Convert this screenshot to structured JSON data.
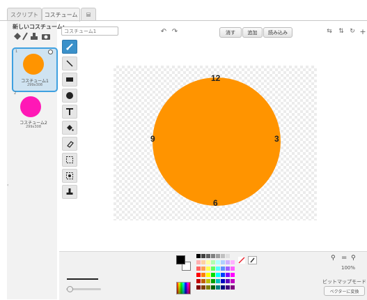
{
  "tabs": [
    {
      "label": "スクリプト",
      "active": false
    },
    {
      "label": "コスチューム",
      "active": true
    },
    {
      "label": "",
      "icon": "speaker-icon",
      "active": false
    }
  ],
  "costume_panel": {
    "new_costume_label": "新しいコスチューム:",
    "new_costume_icons": [
      "paint-brush-icon",
      "stamp-icon",
      "camera-icon"
    ],
    "costumes": [
      {
        "number": "1",
        "name": "コスチューム1",
        "size": "299x308",
        "color": "#ff9400",
        "selected": true
      },
      {
        "number": "2",
        "name": "コスチューム2",
        "size": "299x308",
        "color": "#ff18b6",
        "selected": false
      }
    ]
  },
  "editor": {
    "name_placeholder": "コスチューム1",
    "buttons": {
      "clear": "消す",
      "add": "追加",
      "import": "読み込み"
    },
    "canvas_numbers": {
      "top": "12",
      "right": "3",
      "bottom": "6",
      "left": "9"
    },
    "fill_color": "#ff9400"
  },
  "tools": [
    "brush-icon",
    "line-icon",
    "rectangle-icon",
    "ellipse-icon",
    "text-icon",
    "fill-bucket-icon",
    "eraser-icon",
    "select-icon",
    "stamp-icon",
    "set-center-icon"
  ],
  "colors": {
    "primary": "#000000",
    "secondary": "#ffffff",
    "accent": "#3ea0e0"
  },
  "bottom": {
    "zoom": "100%",
    "mode_label": "ビットマップモード",
    "convert_button": "ベクターに変換"
  }
}
